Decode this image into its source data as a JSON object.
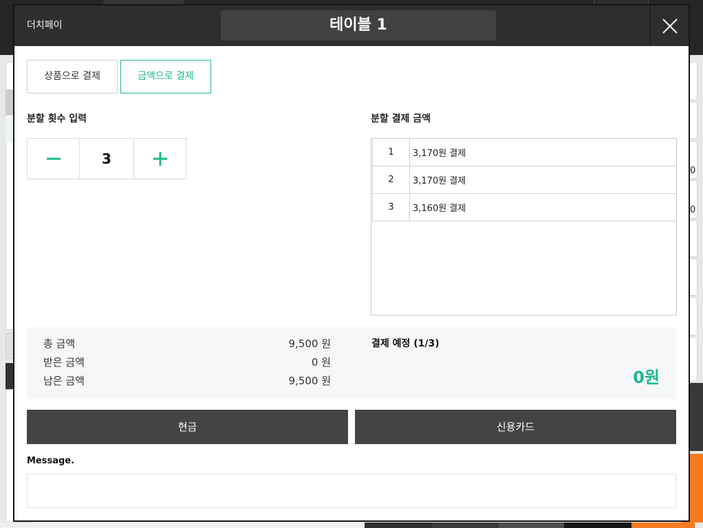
{
  "header": {
    "brand": "더치페이",
    "title": "테이블 1",
    "close_icon": "close-icon"
  },
  "tabs": [
    {
      "label": "상품으로 결제",
      "active": false
    },
    {
      "label": "금액으로 결제",
      "active": true
    }
  ],
  "split_count": {
    "heading": "분할 횟수 입력",
    "value": "3",
    "decrement_icon": "minus-icon",
    "increment_icon": "plus-icon"
  },
  "split_amounts": {
    "heading": "분할 결제 금액",
    "rows": [
      {
        "no": "1",
        "text": "3,170원 결제"
      },
      {
        "no": "2",
        "text": "3,170원 결제"
      },
      {
        "no": "3",
        "text": "3,160원 결제"
      }
    ]
  },
  "summary": {
    "items": [
      {
        "label": "총 금액",
        "value": "9,500 원"
      },
      {
        "label": "받은 금액",
        "value": "0 원"
      },
      {
        "label": "남은 금액",
        "value": "9,500 원"
      }
    ],
    "scheduled_label": "결제 예정 (1/3)",
    "scheduled_amount": "0원"
  },
  "payment_buttons": {
    "cash": "현금",
    "card": "신용카드"
  },
  "message": {
    "label": "Message."
  },
  "background": {
    "right_panel_values": [
      "0",
      "0"
    ]
  },
  "colors": {
    "accent": "#1db98b",
    "header_bg": "#2d2e30",
    "title_bg": "#404143",
    "button_bg": "#434446",
    "summary_bg": "#f6f7f9",
    "app_orange": "#f47b20"
  }
}
